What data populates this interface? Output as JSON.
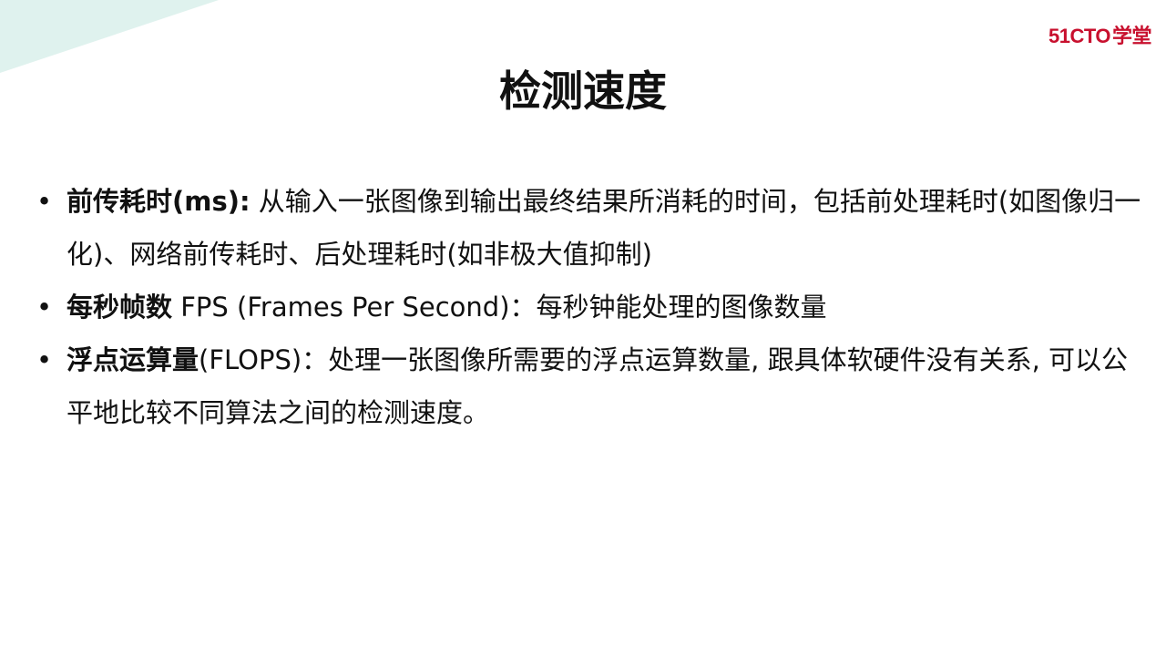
{
  "brand": {
    "logo_text": "51CTO",
    "logo_cn": "学堂",
    "accent_color": "#c8102e"
  },
  "decor": {
    "corner_color": "#dff2ee"
  },
  "title": "检测速度",
  "bullet_symbol": "•",
  "bullets": [
    {
      "term": "前传耗时(ms):",
      "text": " 从输入一张图像到输出最终结果所消耗的时间，包括前处理耗时(如图像归一化)、网络前传耗时、后处理耗时(如非极大值抑制)"
    },
    {
      "term": "每秒帧数",
      "text": " FPS (Frames Per Second)：每秒钟能处理的图像数量"
    },
    {
      "term": "浮点运算量",
      "text": "(FLOPS)：处理一张图像所需要的浮点运算数量, 跟具体软硬件没有关系, 可以公平地比较不同算法之间的检测速度。"
    }
  ]
}
